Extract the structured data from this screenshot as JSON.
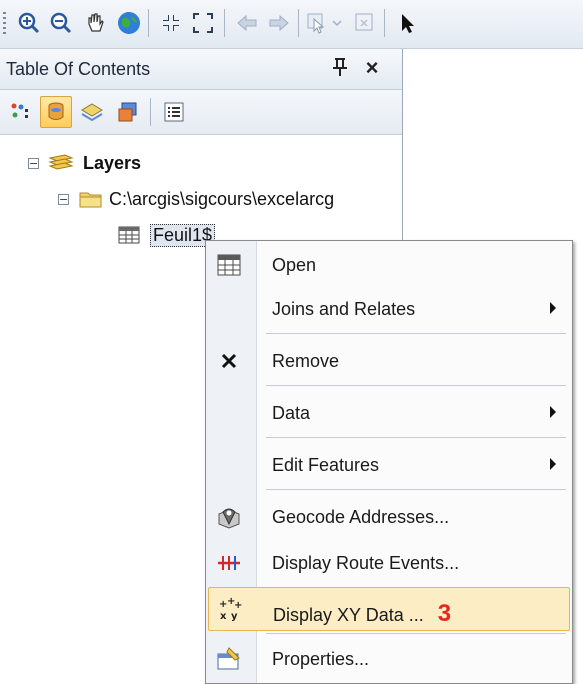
{
  "toolbar": {
    "buttons": [
      "zoom-in-icon",
      "zoom-out-icon",
      "pan-icon",
      "full-extent-icon",
      "fixed-zoom-in-icon",
      "fixed-zoom-out-icon",
      "back-icon",
      "forward-icon",
      "select-features-icon",
      "clear-selection-icon",
      "select-elements-icon"
    ]
  },
  "toc": {
    "title": "Table Of Contents",
    "pin_glyph": "⊥",
    "close_glyph": "×",
    "tree": {
      "root_expander": "−",
      "root_label": "Layers",
      "folder_expander": "−",
      "folder_label": "C:\\arcgis\\sigcours\\excelarcg",
      "table_label": "Feuil1$"
    }
  },
  "context_menu": {
    "items": [
      {
        "label": "Open",
        "icon": "table-icon",
        "submenu": false
      },
      {
        "label": "Joins and Relates",
        "icon": "",
        "submenu": true
      },
      {
        "label": "Remove",
        "icon": "remove-x-icon",
        "submenu": false
      },
      {
        "label": "Data",
        "icon": "",
        "submenu": true
      },
      {
        "label": "Edit Features",
        "icon": "",
        "submenu": true
      },
      {
        "label": "Geocode Addresses...",
        "icon": "geocode-icon",
        "submenu": false
      },
      {
        "label": "Display Route Events...",
        "icon": "route-events-icon",
        "submenu": false
      },
      {
        "label": "Display XY Data ...",
        "icon": "xy-data-icon",
        "submenu": false,
        "highlighted": true,
        "annotation": "3"
      },
      {
        "label": "Properties...",
        "icon": "properties-icon",
        "submenu": false
      }
    ]
  },
  "colors": {
    "highlight_bg": "#fcedc5",
    "annotation_red": "#e8281a",
    "active_button": "#ffcc5a"
  }
}
